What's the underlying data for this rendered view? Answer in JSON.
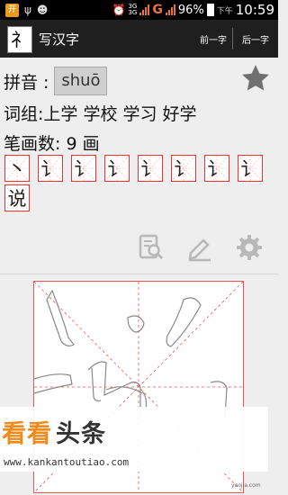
{
  "status_bar": {
    "net_top": "3G",
    "net_bottom": "3G",
    "net_label": "G",
    "battery_pct": "96%",
    "ampm": "下午",
    "time": "10:59"
  },
  "app_bar": {
    "icon_char": "礻",
    "title": "写汉字",
    "prev_label": "前一字",
    "next_label": "后一字"
  },
  "pinyin": {
    "label": "拼音 :",
    "value": "shuō"
  },
  "words": {
    "label": "词组:",
    "items": "上学 学校 学习 好学"
  },
  "strokes": {
    "label": "笔画数: 9 画",
    "cells": [
      "丶",
      "讠",
      "讠",
      "讠",
      "讠",
      "讠",
      "讠",
      "讠",
      "说"
    ]
  },
  "toolbar": {
    "icons": [
      "search-doc-icon",
      "pencil-icon",
      "gear-icon"
    ]
  },
  "watermark": {
    "brand_orange": "看看",
    "brand_dark": "头条",
    "url": "www.kankantoutiao.com",
    "small": "yoojia.com"
  },
  "colors": {
    "grid_red": "#e33333",
    "watermark_orange": "#f08a1b",
    "bar_dark": "#1f1f1f"
  }
}
